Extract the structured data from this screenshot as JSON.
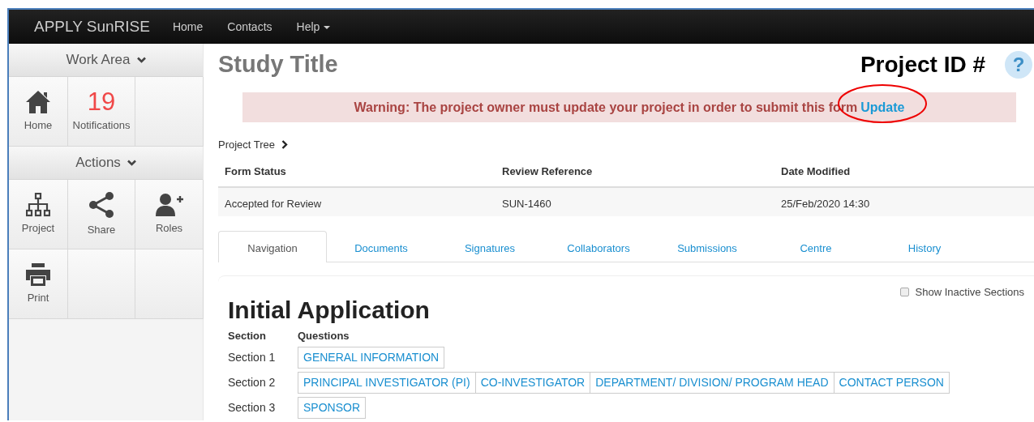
{
  "navbar": {
    "brand": "APPLY SunRISE",
    "links": [
      {
        "label": "Home",
        "dropdown": false
      },
      {
        "label": "Contacts",
        "dropdown": false
      },
      {
        "label": "Help",
        "dropdown": true
      }
    ]
  },
  "sidebar": {
    "sections": [
      {
        "title": "Work Area",
        "tiles": [
          {
            "kind": "home",
            "label": "Home"
          },
          {
            "kind": "count",
            "count": "19",
            "label": "Notifications"
          },
          {
            "kind": "empty"
          }
        ]
      },
      {
        "title": "Actions",
        "tiles": [
          {
            "kind": "hierarchy",
            "label": "Project"
          },
          {
            "kind": "share",
            "label": "Share"
          },
          {
            "kind": "person-add",
            "label": "Roles"
          },
          {
            "kind": "printer",
            "label": "Print"
          },
          {
            "kind": "empty"
          },
          {
            "kind": "empty"
          }
        ]
      }
    ]
  },
  "header": {
    "title": "Study Title",
    "project_id": "Project ID #",
    "help": "?"
  },
  "warning": {
    "text": "Warning: The project owner must update your project in order to submit this form",
    "link": "Update",
    "link_circled": true
  },
  "project_tree": "Project Tree",
  "summary": {
    "columns": [
      "Form Status",
      "Review Reference",
      "Date Modified"
    ],
    "row": [
      "Accepted for Review",
      "SUN-1460",
      "25/Feb/2020 14:30"
    ]
  },
  "tabs": [
    {
      "label": "Navigation",
      "selected": true
    },
    {
      "label": "Documents",
      "selected": false
    },
    {
      "label": "Signatures",
      "selected": false
    },
    {
      "label": "Collaborators",
      "selected": false
    },
    {
      "label": "Submissions",
      "selected": false
    },
    {
      "label": "Centre",
      "selected": false
    },
    {
      "label": "History",
      "selected": false
    }
  ],
  "show_inactive": {
    "label": "Show Inactive Sections",
    "checked": false
  },
  "application": {
    "title": "Initial Application",
    "columns": [
      "Section",
      "Questions"
    ],
    "rows": [
      {
        "section": "Section 1",
        "questions": [
          "GENERAL INFORMATION"
        ]
      },
      {
        "section": "Section 2",
        "questions": [
          "PRINCIPAL INVESTIGATOR (PI)",
          "CO-INVESTIGATOR",
          "DEPARTMENT/ DIVISION/ PROGRAM HEAD",
          "CONTACT PERSON"
        ]
      },
      {
        "section": "Section 3",
        "questions": [
          "SPONSOR"
        ]
      }
    ]
  }
}
